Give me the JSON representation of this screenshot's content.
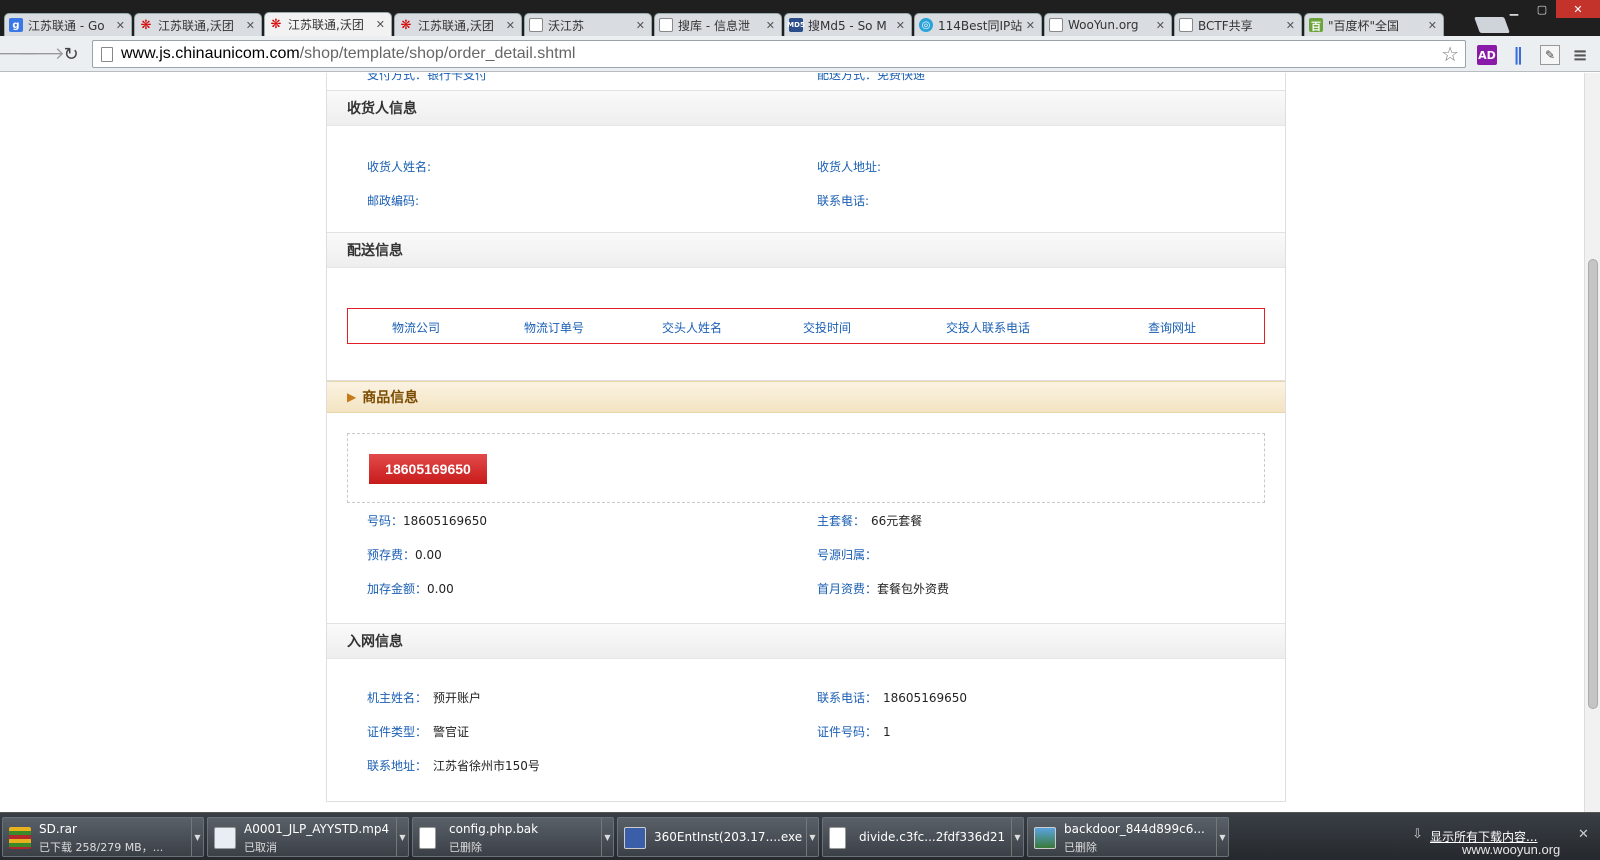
{
  "browser": {
    "tabs": [
      {
        "title": "江苏联通 - Go",
        "favicon": "google-icon",
        "active": false
      },
      {
        "title": "江苏联通,沃团",
        "favicon": "unicom-icon",
        "active": false
      },
      {
        "title": "江苏联通,沃团",
        "favicon": "unicom-icon",
        "active": true
      },
      {
        "title": "江苏联通,沃团",
        "favicon": "unicom-icon",
        "active": false
      },
      {
        "title": "沃江苏",
        "favicon": "page-icon",
        "active": false
      },
      {
        "title": "搜库 - 信息泄",
        "favicon": "page-icon",
        "active": false
      },
      {
        "title": "搜Md5 - So M",
        "favicon": "md5-icon",
        "active": false
      },
      {
        "title": "114Best同IP站",
        "favicon": "globe-icon",
        "active": false
      },
      {
        "title": "WooYun.org",
        "favicon": "page-icon",
        "active": false
      },
      {
        "title": "BCTF共享",
        "favicon": "page-icon",
        "active": false
      },
      {
        "title": "\"百度杯\"全国",
        "favicon": "baidu-icon",
        "active": false
      }
    ],
    "address": {
      "host": "www.js.chinaunicom.com",
      "path": "/shop/template/shop/order_detail.shtml"
    },
    "extensions": {
      "adblock": "AD"
    }
  },
  "page": {
    "top_partial": {
      "left": "支付方式：银行卡支付",
      "right": "配送方式：免费快递"
    },
    "receiver": {
      "title": "收货人信息",
      "name_label": "收货人姓名:",
      "address_label": "收货人地址:",
      "zip_label": "邮政编码:",
      "phone_label": "联系电话:"
    },
    "delivery": {
      "title": "配送信息",
      "columns": [
        "物流公司",
        "物流订单号",
        "交头人姓名",
        "交投时间",
        "交投人联系电话",
        "查询网址"
      ]
    },
    "product": {
      "title": "商品信息",
      "badge": "18605169650",
      "number_label": "号码：",
      "number": "18605169650",
      "plan_label": "主套餐：",
      "plan": "66元套餐",
      "prestore_label": "预存费：",
      "prestore": "0.00",
      "origin_label": "号源归属：",
      "origin": "",
      "extra_label": "加存金额：",
      "extra": "0.00",
      "firstmonth_label": "首月资费：",
      "firstmonth": "套餐包外资费"
    },
    "network": {
      "title": "入网信息",
      "owner_label": "机主姓名：",
      "owner": "预开账户",
      "phone_label": "联系电话：",
      "phone": "18605169650",
      "idtype_label": "证件类型：",
      "idtype": "警官证",
      "idnum_label": "证件号码：",
      "idnum": "1",
      "addr_label": "联系地址：",
      "addr": "江苏省徐州市150号"
    }
  },
  "downloads": {
    "items": [
      {
        "name": "SD.rar",
        "status": "已下载 258/279 MB，...",
        "icon": "rar-icon"
      },
      {
        "name": "A0001_JLP_AYYSTD.mp4",
        "status": "已取消",
        "icon": "video-icon"
      },
      {
        "name": "config.php.bak",
        "status": "已删除",
        "icon": "file-icon"
      },
      {
        "name": "360EntInst(203.17....exe",
        "status": "",
        "icon": "installer-icon"
      },
      {
        "name": "divide.c3fc...2fdf336d21",
        "status": "",
        "icon": "file-icon"
      },
      {
        "name": "backdoor_844d899c6...",
        "status": "已删除",
        "icon": "image-icon"
      }
    ],
    "show_all": "显示所有下载内容..."
  },
  "watermark": "www.wooyun.org"
}
